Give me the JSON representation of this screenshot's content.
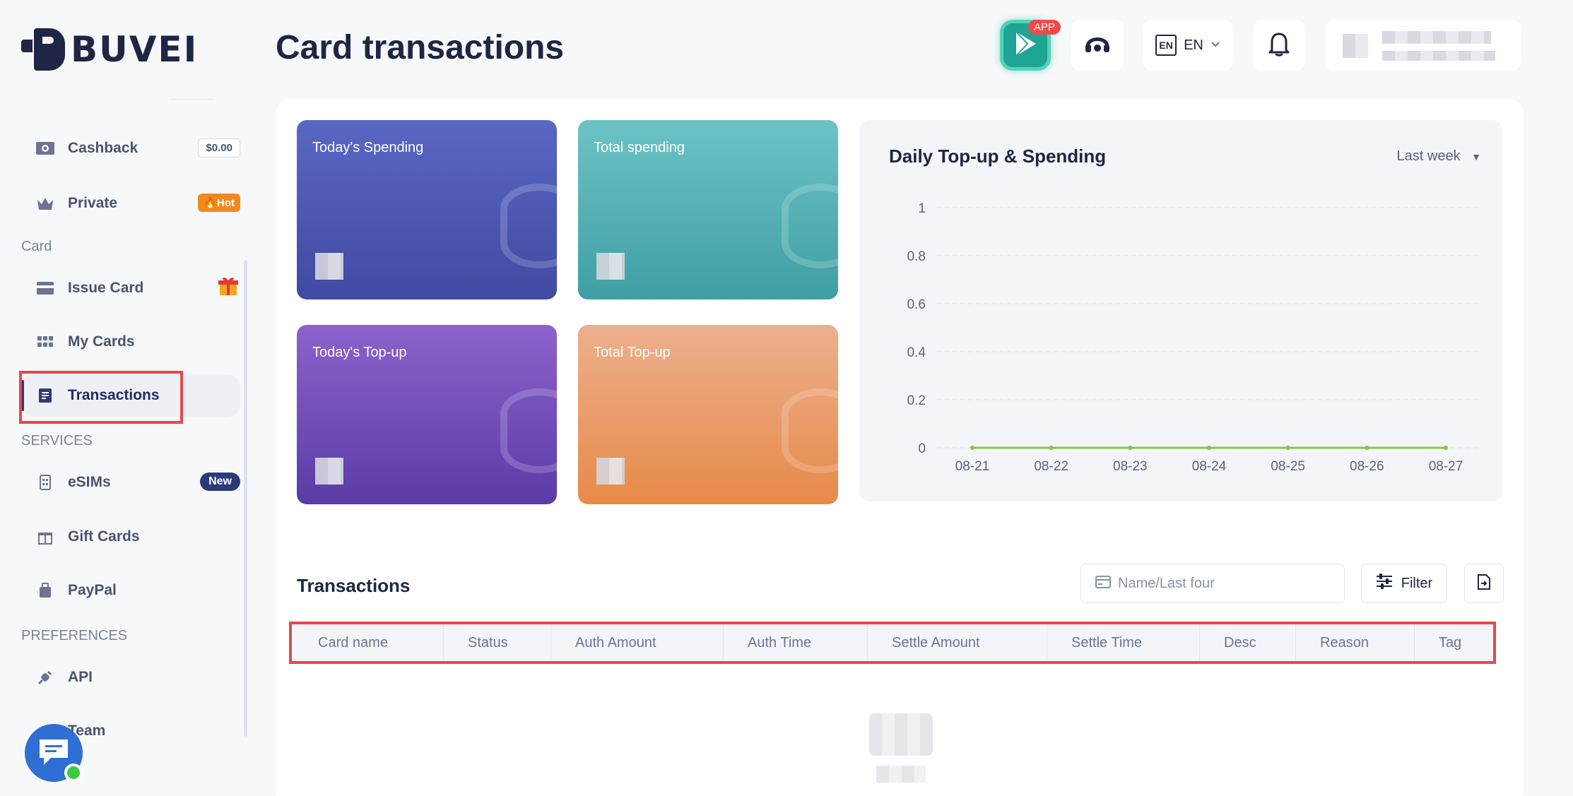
{
  "app": {
    "brand": "BUVEI",
    "page_title": "Card transactions"
  },
  "header": {
    "app_badge": "APP",
    "language": "EN",
    "language_icon_text": "EN"
  },
  "sidebar": {
    "items_top": [
      {
        "label": "Cashback",
        "badge": "$0.00"
      },
      {
        "label": "Private",
        "badge": "Hot"
      }
    ],
    "section_card": "Card",
    "card_items": [
      {
        "label": "Issue Card"
      },
      {
        "label": "My Cards"
      },
      {
        "label": "Transactions"
      }
    ],
    "section_services": "SERVICES",
    "services_items": [
      {
        "label": "eSIMs",
        "badge": "New"
      },
      {
        "label": "Gift Cards"
      },
      {
        "label": "PayPal"
      }
    ],
    "section_preferences": "PREFERENCES",
    "preferences_items": [
      {
        "label": "API"
      },
      {
        "label": "Team"
      }
    ]
  },
  "stats": {
    "today_spending": "Today's Spending",
    "total_spending": "Total spending",
    "today_topup": "Today's Top-up",
    "total_topup": "Total Top-up"
  },
  "chart_data": {
    "type": "line",
    "title": "Daily Top-up & Spending",
    "range_label": "Last week",
    "categories": [
      "08-21",
      "08-22",
      "08-23",
      "08-24",
      "08-25",
      "08-26",
      "08-27"
    ],
    "y_ticks": [
      "1",
      "0.8",
      "0.6",
      "0.4",
      "0.2",
      "0"
    ],
    "ylim": [
      0,
      1
    ],
    "grid": true,
    "series": [
      {
        "values": [
          0,
          0,
          0,
          0,
          0,
          0,
          0
        ],
        "color": "#3f9ea5"
      },
      {
        "values": [
          0,
          0,
          0,
          0,
          0,
          0,
          0
        ],
        "color": "#8bc34a"
      }
    ]
  },
  "transactions": {
    "title": "Transactions",
    "search_placeholder": "Name/Last four",
    "filter_label": "Filter",
    "columns": [
      "Card name",
      "Status",
      "Auth Amount",
      "Auth Time",
      "Settle Amount",
      "Settle Time",
      "Desc",
      "Reason",
      "Tag"
    ]
  }
}
